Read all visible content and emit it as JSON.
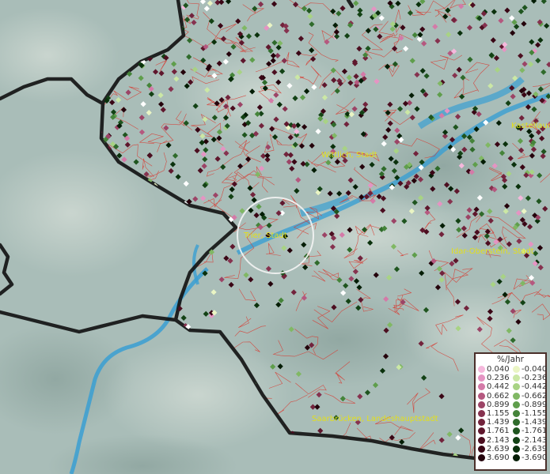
{
  "cities": [
    {
      "name": "Wittlich, Stadt"
    },
    {
      "name": "Kastellaun"
    },
    {
      "name": "Trier, Stadt"
    },
    {
      "name": "Idar-Oberstein, Stadt"
    },
    {
      "name": "Saarbrücken, Landeshauptstadt"
    }
  ],
  "legend": {
    "title": "%/Jahr",
    "positive": [
      {
        "label": "0.040",
        "color": "#f5b8dc"
      },
      {
        "label": "0.236",
        "color": "#e594c3"
      },
      {
        "label": "0.442",
        "color": "#d47aa8"
      },
      {
        "label": "0.662",
        "color": "#b5587f"
      },
      {
        "label": "0.899",
        "color": "#9c4466"
      },
      {
        "label": "1.155",
        "color": "#86324f"
      },
      {
        "label": "1.439",
        "color": "#72233c"
      },
      {
        "label": "1.761",
        "color": "#5f172d"
      },
      {
        "label": "2.143",
        "color": "#4c0e20"
      },
      {
        "label": "2.639",
        "color": "#3a0615"
      },
      {
        "label": "3.690",
        "color": "#24020b"
      }
    ],
    "negative": [
      {
        "label": "-0.040",
        "color": "#eaf5c4"
      },
      {
        "label": "-0.236",
        "color": "#cbe8a5"
      },
      {
        "label": "-0.442",
        "color": "#a8d384"
      },
      {
        "label": "-0.662",
        "color": "#80b864"
      },
      {
        "label": "-0.899",
        "color": "#5f9e4c"
      },
      {
        "label": "-1.155",
        "color": "#45843a"
      },
      {
        "label": "-1.439",
        "color": "#2f6b2b"
      },
      {
        "label": "-1.761",
        "color": "#1f551f"
      },
      {
        "label": "-2.143",
        "color": "#134215"
      },
      {
        "label": "-2.639",
        "color": "#0a310c"
      },
      {
        "label": "-3.690",
        "color": "#041d05"
      }
    ]
  },
  "colors": {
    "terrain": "#a9bdb8",
    "water": "#3a9fd2",
    "border": "#111111",
    "district_lines": "#d8382f",
    "label_text": "#e3df1a"
  },
  "icons": [
    "focus-circle-icon"
  ]
}
